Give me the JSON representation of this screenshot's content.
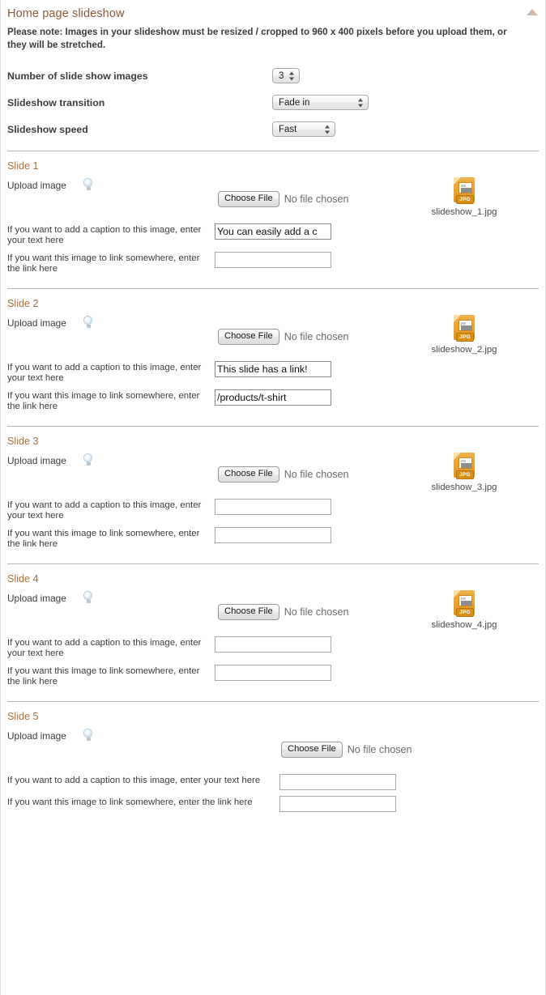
{
  "header": {
    "title": "Home page slideshow",
    "collapse_icon": "triangle-up-icon"
  },
  "note": "Please note: Images in your slideshow must be resized / cropped to 960 x 400 pixels before you upload them, or they will be stretched.",
  "settings": [
    {
      "label": "Number of slide show images",
      "value": "3",
      "size": "w-small"
    },
    {
      "label": "Slideshow transition",
      "value": "Fade in",
      "size": "w-big"
    },
    {
      "label": "Slideshow speed",
      "value": "Fast",
      "size": "w-mid"
    }
  ],
  "common": {
    "upload_label": "Upload image",
    "help_icon": "lightbulb-icon",
    "choose_file_label": "Choose File",
    "no_file_label": "No file chosen",
    "caption_label": "If you want to add a caption to this image, enter your text here",
    "link_label": "If you want this image to link somewhere, enter the link here",
    "file_icon": "jpg-file-icon",
    "file_badge": "JPG"
  },
  "slides": [
    {
      "title": "Slide 1",
      "filename": "slideshow_1.jpg",
      "has_thumb": true,
      "caption_value": "You can easily add a c",
      "link_value": ""
    },
    {
      "title": "Slide 2",
      "filename": "slideshow_2.jpg",
      "has_thumb": true,
      "caption_value": "This slide has a link!",
      "link_value": "/products/t-shirt"
    },
    {
      "title": "Slide 3",
      "filename": "slideshow_3.jpg",
      "has_thumb": true,
      "caption_value": "",
      "link_value": ""
    },
    {
      "title": "Slide 4",
      "filename": "slideshow_4.jpg",
      "has_thumb": true,
      "caption_value": "",
      "link_value": ""
    },
    {
      "title": "Slide 5",
      "filename": "",
      "has_thumb": false,
      "caption_value": "",
      "link_value": ""
    }
  ],
  "colors": {
    "panel_title": "#8d5c3c",
    "slide_title": "#a7713f",
    "divider": "#b5b5b5",
    "icon_gold": "#e8a135"
  }
}
